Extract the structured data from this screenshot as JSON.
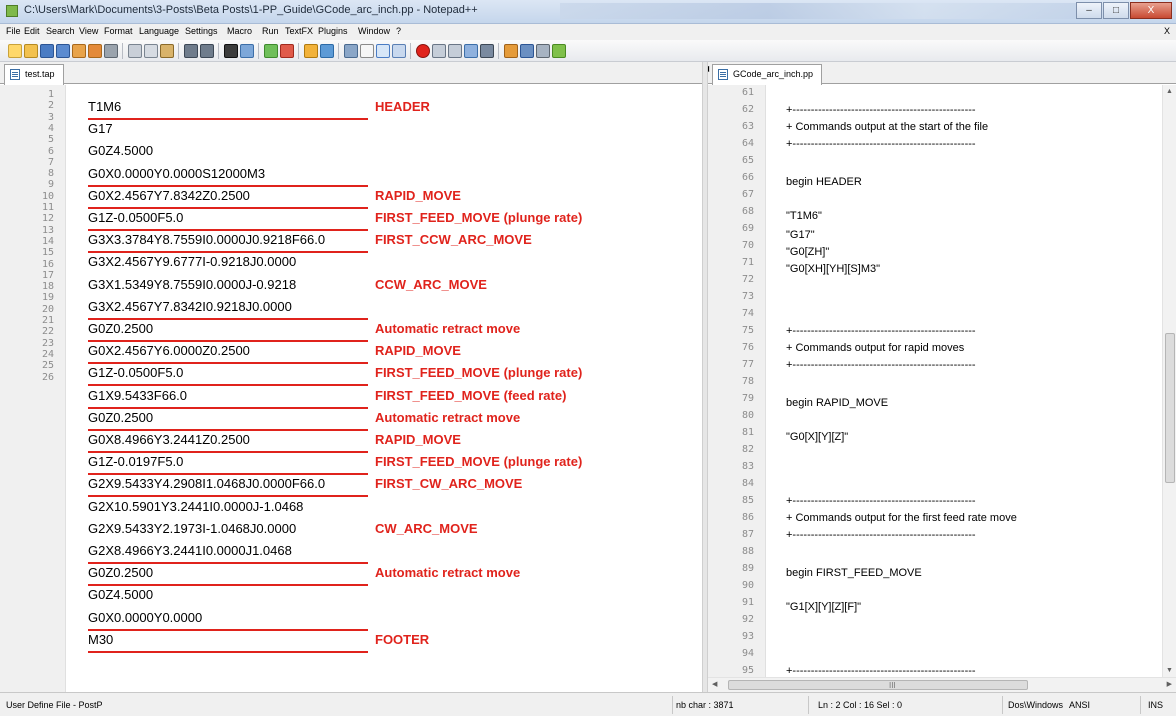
{
  "window": {
    "title": "C:\\Users\\Mark\\Documents\\3-Posts\\Beta Posts\\1-PP_Guide\\GCode_arc_inch.pp - Notepad++",
    "minimize_label": "–",
    "maximize_label": "□",
    "close_label": "X"
  },
  "menu": {
    "items": [
      "File",
      "Edit",
      "Search",
      "View",
      "Format",
      "Language",
      "Settings",
      "Macro",
      "Run",
      "TextFX",
      "Plugins",
      "Window",
      "?"
    ],
    "close_doc_label": "X"
  },
  "toolbar_icons": [
    "new-file-icon",
    "open-file-icon",
    "save-icon",
    "save-all-icon",
    "close-icon",
    "close-all-icon",
    "print-icon",
    "cut-icon",
    "copy-icon",
    "paste-icon",
    "undo-icon",
    "redo-icon",
    "find-icon",
    "replace-icon",
    "zoom-in-icon",
    "zoom-out-icon",
    "sync-v-icon",
    "sync-h-icon",
    "word-wrap-icon",
    "show-all-chars-icon",
    "indent-guide-icon",
    "fold-icon",
    "record-macro-icon",
    "stop-macro-icon",
    "play-macro-icon",
    "run-macro-multiple-icon",
    "save-macro-icon",
    "open-in-browser-icon",
    "panel-icon",
    "monitor-icon",
    "spellcheck-icon"
  ],
  "colors": {
    "annotation": "#e0231c",
    "tab_icon": "#3a6ea5",
    "line_number": "#8c8c8c"
  },
  "left_editor": {
    "tab_label": "test.tap",
    "line_numbers": [
      "1",
      "2",
      "3",
      "4",
      "5",
      "6",
      "7",
      "8",
      "9",
      "10",
      "11",
      "12",
      "13",
      "14",
      "15",
      "16",
      "17",
      "18",
      "19",
      "20",
      "21",
      "22",
      "23",
      "24",
      "25",
      "26"
    ],
    "code_lines": [
      "T1M6",
      "G17",
      "G0Z4.5000",
      "G0X0.0000Y0.0000S12000M3",
      "G0X2.4567Y7.8342Z0.2500",
      "G1Z-0.0500F5.0",
      "G3X3.3784Y8.7559I0.0000J0.9218F66.0",
      "G3X2.4567Y9.6777I-0.9218J0.0000",
      "G3X1.5349Y8.7559I0.0000J-0.9218",
      "G3X2.4567Y7.8342I0.9218J0.0000",
      "G0Z0.2500",
      "G0X2.4567Y6.0000Z0.2500",
      "G1Z-0.0500F5.0",
      "G1X9.5433F66.0",
      "G0Z0.2500",
      "G0X8.4966Y3.2441Z0.2500",
      "G1Z-0.0197F5.0",
      "G2X9.5433Y4.2908I1.0468J0.0000F66.0",
      "G2X10.5901Y3.2441I0.0000J-1.0468",
      "G2X9.5433Y2.1973I-1.0468J0.0000",
      "G2X8.4966Y3.2441I0.0000J1.0468",
      "G0Z0.2500",
      "G0Z4.5000",
      "G0X0.0000Y0.0000",
      "M30"
    ],
    "annotations": [
      "HEADER",
      "RAPID_MOVE",
      "FIRST_FEED_MOVE (plunge rate)",
      "FIRST_CCW_ARC_MOVE",
      "CCW_ARC_MOVE",
      "Automatic retract move",
      "RAPID_MOVE",
      "FIRST_FEED_MOVE (plunge rate)",
      "FIRST_FEED_MOVE (feed rate)",
      "Automatic retract move",
      "RAPID_MOVE",
      "FIRST_FEED_MOVE (plunge rate)",
      "FIRST_CW_ARC_MOVE",
      "CW_ARC_MOVE",
      "Automatic retract move",
      "FOOTER"
    ]
  },
  "right_editor": {
    "tab_label": "GCode_arc_inch.pp",
    "line_numbers": [
      "61",
      "62",
      "63",
      "64",
      "65",
      "66",
      "67",
      "68",
      "69",
      "70",
      "71",
      "72",
      "73",
      "74",
      "75",
      "76",
      "77",
      "78",
      "79",
      "80",
      "81",
      "82",
      "83",
      "84",
      "85",
      "86",
      "87",
      "88",
      "89",
      "90",
      "91",
      "92",
      "93",
      "94",
      "95"
    ],
    "lines": [
      "+--------------------------------------------------",
      "+ Commands output at the start of the file",
      "+--------------------------------------------------",
      "begin HEADER",
      "\"T1M6\"",
      "\"G17\"",
      "\"G0[ZH]\"",
      "\"G0[XH][YH][S]M3\"",
      "+--------------------------------------------------",
      "+ Commands output for rapid moves",
      "+--------------------------------------------------",
      "begin RAPID_MOVE",
      "\"G0[X][Y][Z]\"",
      "+--------------------------------------------------",
      "+ Commands output for the first feed rate move",
      "+--------------------------------------------------",
      "begin FIRST_FEED_MOVE",
      "\"G1[X][Y][Z][F]\"",
      "+--------------------------------------------------"
    ],
    "hscroll_grip": "III"
  },
  "status": {
    "filetype": "User Define File - PostP",
    "nb_char": "nb char : 3871",
    "position": "Ln : 2    Col : 16    Sel : 0",
    "eol": "Dos\\Windows",
    "encoding": "ANSI",
    "mode": "INS"
  }
}
